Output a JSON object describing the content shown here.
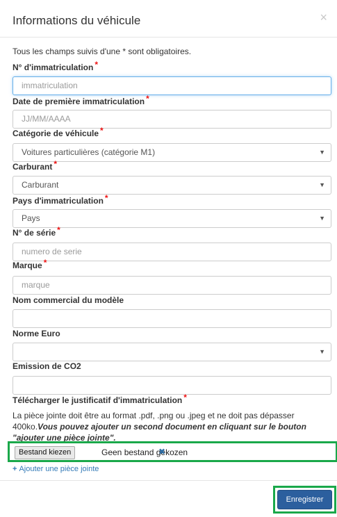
{
  "modal": {
    "title": "Informations du véhicule",
    "close": "×",
    "required_note": "Tous les champs suivis d'une * sont obligatoires."
  },
  "fields": {
    "immatriculation": {
      "label": "N° d'immatriculation",
      "placeholder": "immatriculation"
    },
    "date": {
      "label": "Date de première immatriculation",
      "placeholder": "JJ/MM/AAAA"
    },
    "categorie": {
      "label": "Catégorie de véhicule",
      "value": "Voitures particulières (catégorie M1)"
    },
    "carburant": {
      "label": "Carburant",
      "value": "Carburant"
    },
    "pays": {
      "label": "Pays d'immatriculation",
      "value": "Pays"
    },
    "serie": {
      "label": "N° de série",
      "placeholder": "numero de serie"
    },
    "marque": {
      "label": "Marque",
      "placeholder": "marque"
    },
    "modele": {
      "label": "Nom commercial du modèle",
      "value": ""
    },
    "norme": {
      "label": "Norme Euro",
      "value": ""
    },
    "co2": {
      "label": "Emission de CO2",
      "value": ""
    }
  },
  "required_star": "*",
  "upload": {
    "label": "Télécharger le justificatif d'immatriculation",
    "help_plain": "La pièce jointe doit être au format .pdf, .png ou .jpeg et ne doit pas dépasser 400ko.",
    "help_bold": "Vous pouvez ajouter un second document en cliquant sur le bouton \"ajouter une pièce jointe\".",
    "button": "Bestand kiezen",
    "no_file": "Geen bestand gekozen",
    "remove_icon": "✖",
    "add_icon": "+",
    "add_label": "Ajouter une pièce jointe"
  },
  "footer": {
    "save_label": "Enregistrer"
  },
  "colors": {
    "accent": "#2c5f9e",
    "highlight": "#1aa84a",
    "required": "#e11111",
    "link": "#337ab7"
  }
}
